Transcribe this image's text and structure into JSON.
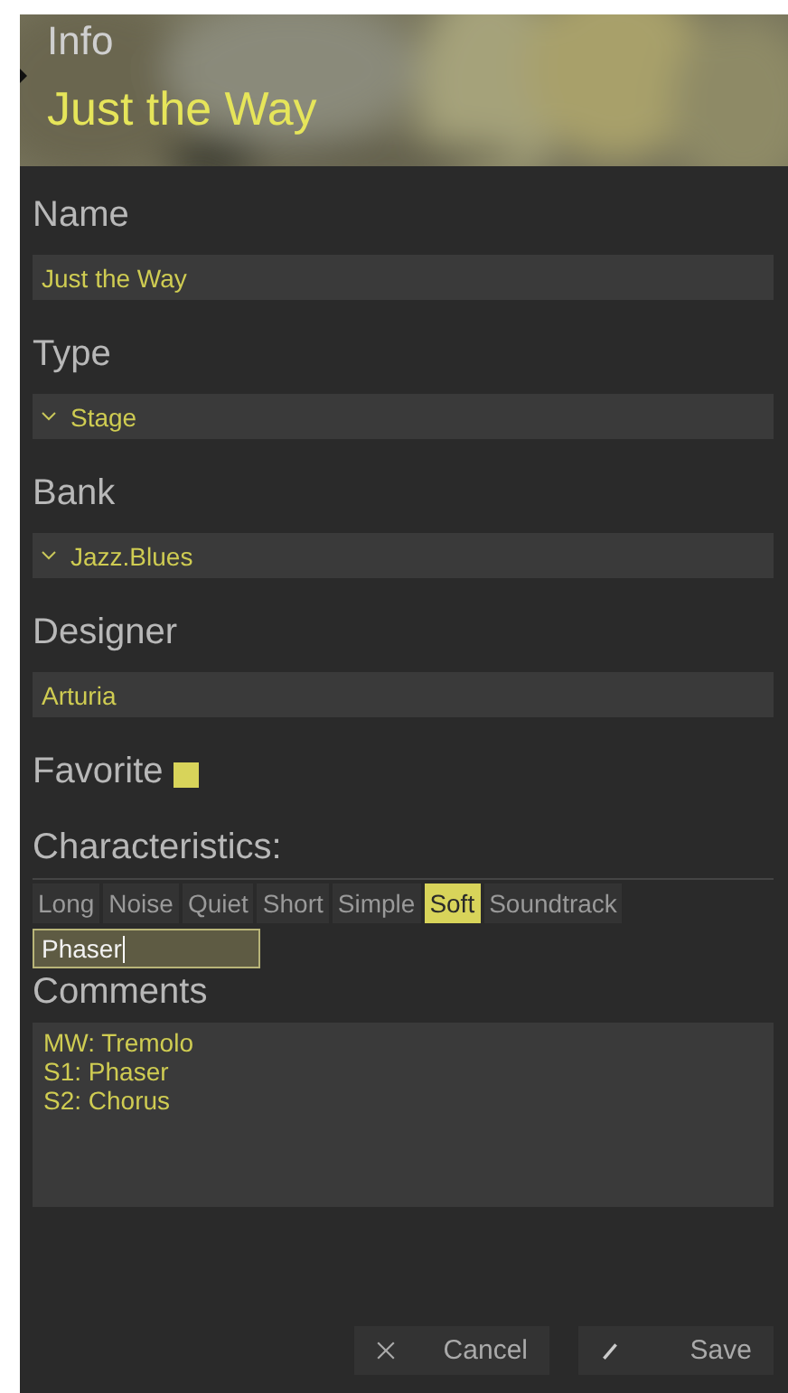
{
  "header": {
    "kind": "picture",
    "title": "Info",
    "preset_name": "Just the Way"
  },
  "fields": [
    {
      "label": "Name",
      "kind": "text",
      "value": "Just the Way"
    },
    {
      "label": "Type",
      "kind": "dropdown",
      "value": "Stage"
    },
    {
      "label": "Bank",
      "kind": "dropdown",
      "value": "Jazz.Blues"
    },
    {
      "label": "Designer",
      "kind": "text",
      "value": "Arturia"
    }
  ],
  "favorite": {
    "label": "Favorite",
    "checked": true
  },
  "characteristics": {
    "label": "Characteristics:",
    "tags": [
      {
        "label": "Long",
        "selected": false
      },
      {
        "label": "Noise",
        "selected": false
      },
      {
        "label": "Quiet",
        "selected": false
      },
      {
        "label": "Short",
        "selected": false
      },
      {
        "label": "Simple",
        "selected": false
      },
      {
        "label": "Soft",
        "selected": true
      },
      {
        "label": "Soundtrack",
        "selected": false
      }
    ],
    "new_tag_value": "Phaser"
  },
  "comments": {
    "label": "Comments",
    "lines": [
      "MW: Tremolo",
      "S1: Phaser",
      "S2: Chorus"
    ]
  },
  "buttons": [
    {
      "kind": "cancel",
      "label": "Cancel"
    },
    {
      "kind": "save",
      "label": "Save"
    }
  ]
}
